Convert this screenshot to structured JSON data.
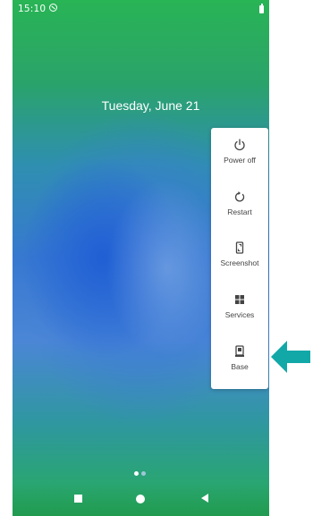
{
  "status_bar": {
    "time": "15:10",
    "notification_icon": "do-not-disturb-icon",
    "battery_icon": "battery-icon"
  },
  "lock_screen": {
    "date": "Tuesday, June 21"
  },
  "power_menu": {
    "items": [
      {
        "label": "Power off",
        "icon": "power-icon"
      },
      {
        "label": "Restart",
        "icon": "restart-icon"
      },
      {
        "label": "Screenshot",
        "icon": "screenshot-icon"
      },
      {
        "label": "Services",
        "icon": "grid-icon"
      },
      {
        "label": "Base",
        "icon": "base-icon"
      }
    ]
  },
  "page_indicator": {
    "active_color": "#ffffff",
    "inactive_color": "#9fc7d9"
  },
  "nav_bar": {
    "buttons": [
      "recents-square-icon",
      "home-circle-icon",
      "back-triangle-icon"
    ]
  },
  "annotation": {
    "arrow_color": "#13a8a8"
  }
}
